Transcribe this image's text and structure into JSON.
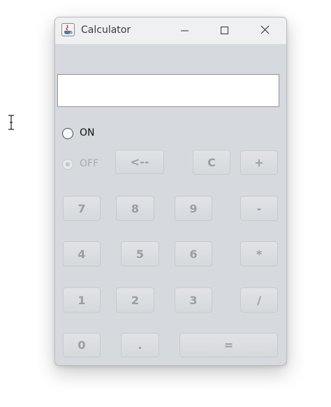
{
  "window": {
    "title": "Calculator",
    "app_icon": "java-coffee-cup-icon",
    "controls": [
      "minimize-icon",
      "maximize-icon",
      "close-icon"
    ]
  },
  "display": {
    "value": ""
  },
  "power": {
    "on_label": "ON",
    "off_label": "OFF",
    "selected": "OFF"
  },
  "keys": {
    "backspace": "<--",
    "clear": "C",
    "add": "+",
    "seven": "7",
    "eight": "8",
    "nine": "9",
    "subtract": "-",
    "four": "4",
    "five": "5",
    "six": "6",
    "multiply": "*",
    "one": "1",
    "two": "2",
    "three": "3",
    "divide": "/",
    "zero": "0",
    "decimal": ".",
    "equals": "="
  },
  "colors": {
    "window_bg": "#d6d9dd",
    "titlebar_bg": "#eff0f2",
    "key_text_disabled": "#9a9da2",
    "display_bg": "#ffffff"
  }
}
